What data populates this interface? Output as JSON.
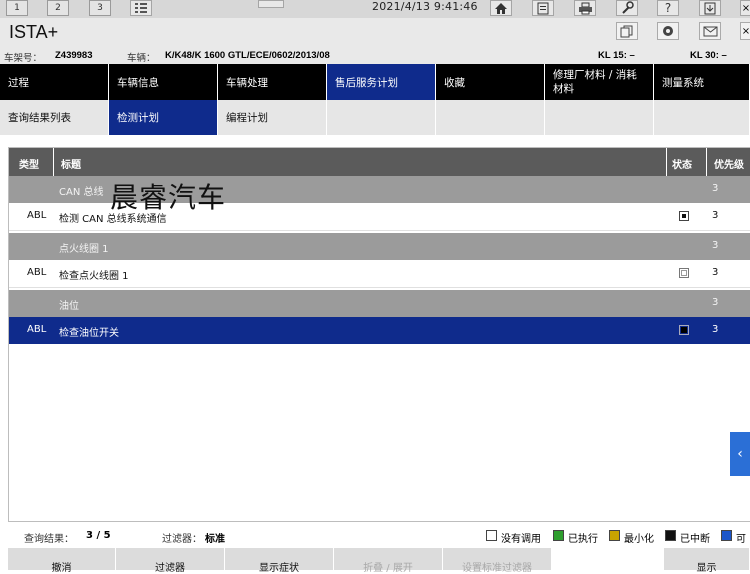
{
  "topbar": {
    "tabs": [
      "1",
      "2",
      "3"
    ],
    "datetime": "2021/4/13 9:41:46"
  },
  "app": {
    "title": "ISTA+"
  },
  "vehicle": {
    "vin_label": "车架号：",
    "vin": "Z439983",
    "vehicle_label": "车辆：",
    "vehicle": "K/K48/K 1600 GTL/ECE/0602/2013/08",
    "kl15": "KL 15:  –",
    "kl30": "KL 30:  –"
  },
  "nav": {
    "main": [
      "过程",
      "车辆信息",
      "车辆处理",
      "售后服务计划",
      "收藏",
      "修理厂材料 / 消耗材料",
      "测量系统"
    ],
    "sub": [
      "查询结果列表",
      "检测计划",
      "编程计划"
    ]
  },
  "table": {
    "headers": {
      "type": "类型",
      "title": "标题",
      "status": "状态",
      "priority": "优先级"
    },
    "rows": [
      {
        "kind": "group",
        "title": "CAN 总线",
        "priority": "3"
      },
      {
        "kind": "item",
        "type": "ABL",
        "title": "检测 CAN 总线系统通信",
        "status": "filled",
        "priority": "3"
      },
      {
        "kind": "group",
        "title": "点火线圈 1",
        "priority": "3"
      },
      {
        "kind": "item",
        "type": "ABL",
        "title": "检查点火线圈 1",
        "status": "empty",
        "priority": "3"
      },
      {
        "kind": "group",
        "title": "油位",
        "priority": "3"
      },
      {
        "kind": "selected",
        "type": "ABL",
        "title": "检查油位开关",
        "status": "filled",
        "priority": "3"
      }
    ]
  },
  "watermark": "晨睿汽车",
  "status": {
    "result_label": "查询结果：",
    "result_value": "3 / 5",
    "filter_label": "过滤器：",
    "filter_value": "标准",
    "legend": [
      {
        "label": "没有调用",
        "color": "#ffffff"
      },
      {
        "label": "已执行",
        "color": "#2e9e2e"
      },
      {
        "label": "最小化",
        "color": "#c8a400"
      },
      {
        "label": "已中断",
        "color": "#111111"
      },
      {
        "label": "可",
        "color": "#1b55c9"
      }
    ]
  },
  "buttons": [
    "撤消",
    "过滤器",
    "显示症状",
    "折叠 / 展开",
    "设置标准过滤器",
    "显示"
  ]
}
